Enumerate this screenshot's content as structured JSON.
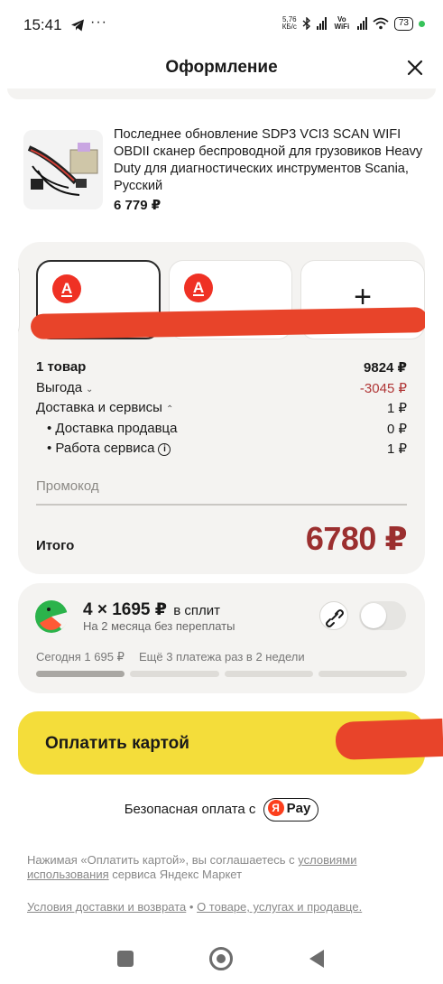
{
  "status_bar": {
    "time": "15:41",
    "dots": "···",
    "net_speed_value": "5,76",
    "net_speed_unit": "КБ/с",
    "vowifi": "Vo WiFi",
    "battery": "73"
  },
  "header": {
    "title": "Оформление"
  },
  "product": {
    "title": "Последнее обновление SDP3 VCI3 SCAN WIFI OBDII сканер беспроводной для грузовиков Heavy Duty для диагностических инструментов Scania, Русский",
    "price": "6 779 ₽"
  },
  "payment_methods": {
    "card_icon_letter": "А",
    "add_symbol": "+"
  },
  "summary": {
    "items": {
      "label": "1 товар",
      "value": "9824 ₽"
    },
    "benefit": {
      "label": "Выгода",
      "value": "-3045 ₽"
    },
    "delivery": {
      "label": "Доставка и сервисы",
      "value": "1 ₽"
    },
    "seller_delivery": {
      "label": "Доставка продавца",
      "value": "0 ₽"
    },
    "service_work": {
      "label": "Работа сервиса",
      "value": "1 ₽"
    },
    "promo_placeholder": "Промокод",
    "total": {
      "label": "Итого",
      "value": "6780 ₽"
    }
  },
  "split": {
    "title_amount": "4 × 1695 ₽",
    "title_tail": "в сплит",
    "subtitle": "На 2 месяца без переплаты",
    "today": "Сегодня 1 695 ₽",
    "rest": "Ещё 3 платежа раз в 2 недели",
    "paid_segments": 1,
    "total_segments": 4,
    "enabled": false
  },
  "pay_button": {
    "label": "Оплатить картой"
  },
  "secure": {
    "text": "Безопасная оплата с",
    "ya_letter": "Я",
    "pay_text": "Pay"
  },
  "legal": {
    "prefix": "Нажимая «Оплатить картой», вы соглашаетесь с ",
    "link": "условиями использования",
    "suffix": " сервиса Яндекс Маркет"
  },
  "links": {
    "delivery_returns": "Условия доставки и возврата",
    "separator": " • ",
    "about": "О товаре, услугах и продавце."
  },
  "colors": {
    "accent_yellow": "#f4dd3a",
    "total_red": "#9b2f2f",
    "alfa_red": "#ef3124",
    "redaction": "#e8442a"
  }
}
